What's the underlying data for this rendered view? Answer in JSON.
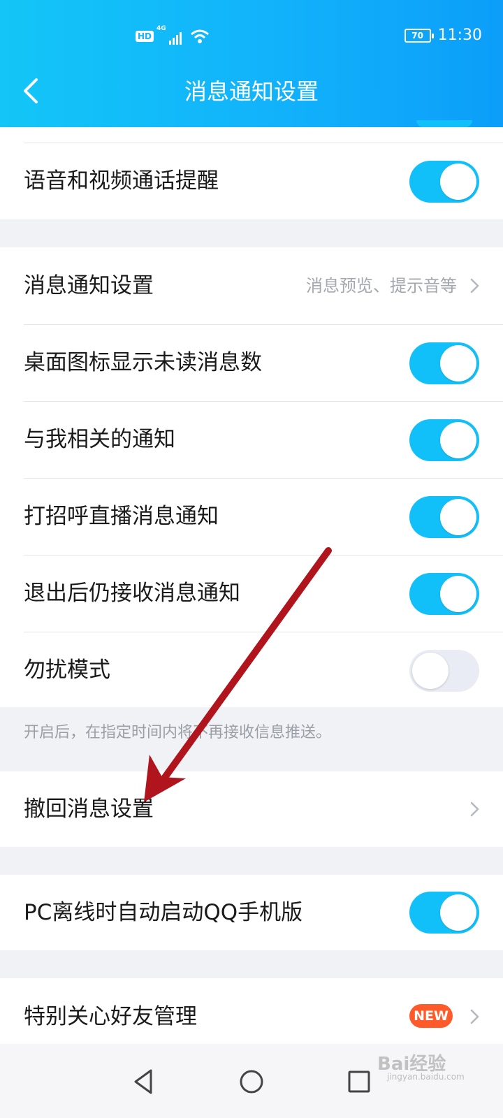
{
  "status_bar": {
    "hd": "HD",
    "network": "4G",
    "battery": "70",
    "time": "11:30"
  },
  "header": {
    "title": "消息通知设置"
  },
  "rows": {
    "voice_video": {
      "label": "语音和视频通话提醒",
      "on": true
    },
    "message_notify": {
      "label": "消息通知设置",
      "hint": "消息预览、提示音等"
    },
    "unread_badge": {
      "label": "桌面图标显示未读消息数",
      "on": true
    },
    "related_notify": {
      "label": "与我相关的通知",
      "on": true
    },
    "live_notify": {
      "label": "打招呼直播消息通知",
      "on": true
    },
    "after_exit": {
      "label": "退出后仍接收消息通知",
      "on": true
    },
    "dnd": {
      "label": "勿扰模式",
      "on": false
    },
    "recall": {
      "label": "撤回消息设置"
    },
    "pc_offline": {
      "label": "PC离线时自动启动QQ手机版",
      "on": true
    },
    "special_friends": {
      "label": "特别关心好友管理",
      "badge": "NEW"
    }
  },
  "dnd_note": "开启后，在指定时间内将不再接收信息推送。",
  "watermark": {
    "text": "Bai经验",
    "url": "jingyan.baidu.com"
  },
  "colors": {
    "header_start": "#13c6f7",
    "header_end": "#0c9ef9",
    "toggle_on": "#12c0f9",
    "toggle_off": "#e9ecf4",
    "badge": "#ff5a2a",
    "annotation_arrow": "#b0141c"
  },
  "icons": {
    "back": "chevron-left-icon",
    "chevron": "chevron-right-icon",
    "nav_back": "triangle-back-icon",
    "nav_home": "circle-home-icon",
    "nav_recent": "square-recent-icon"
  }
}
